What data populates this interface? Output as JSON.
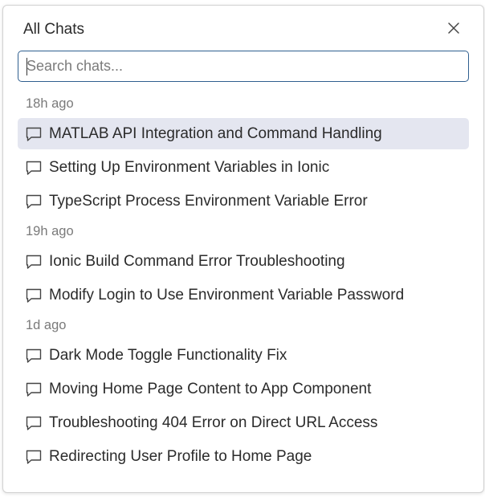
{
  "dialog": {
    "title": "All Chats",
    "close_icon": "close-icon"
  },
  "search": {
    "placeholder": "Search chats...",
    "value": ""
  },
  "groups": [
    {
      "label": "18h ago",
      "items": [
        {
          "label": "MATLAB API Integration and Command Handling",
          "active": true
        },
        {
          "label": "Setting Up Environment Variables in Ionic"
        },
        {
          "label": "TypeScript Process Environment Variable Error"
        }
      ]
    },
    {
      "label": "19h ago",
      "items": [
        {
          "label": "Ionic Build Command Error Troubleshooting"
        },
        {
          "label": "Modify Login to Use Environment Variable Password"
        }
      ]
    },
    {
      "label": "1d ago",
      "items": [
        {
          "label": "Dark Mode Toggle Functionality Fix"
        },
        {
          "label": "Moving Home Page Content to App Component"
        },
        {
          "label": "Troubleshooting 404 Error on Direct URL Access"
        },
        {
          "label": "Redirecting User Profile to Home Page"
        }
      ]
    }
  ],
  "item_icon": "chat-bubble-icon",
  "colors": {
    "active_bg": "#e4e6f0",
    "search_border": "#2f5f8f",
    "group_label": "#7a7a7a"
  }
}
